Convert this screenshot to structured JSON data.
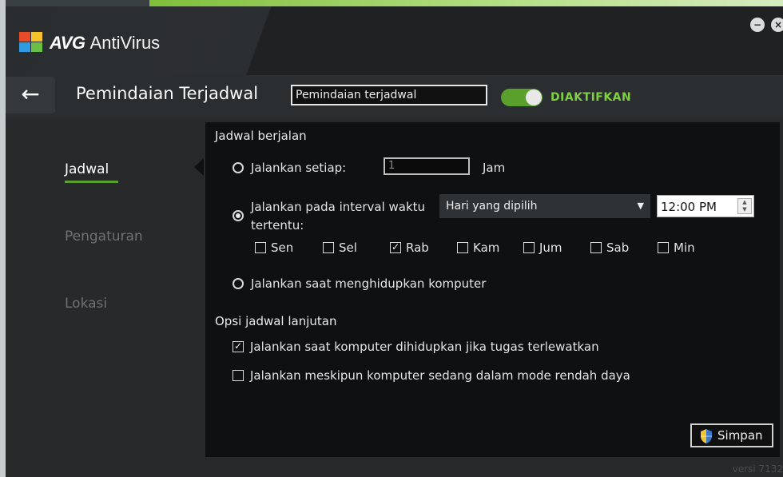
{
  "app": {
    "brand": "AVG",
    "product": "AntiVirus"
  },
  "window_controls": {
    "minimize": "−",
    "close": "×"
  },
  "title_bar": {
    "back_icon": "←",
    "page_title": "Pemindaian Terjadwal",
    "name_value": "Pemindaian terjadwal",
    "toggle_state": "on",
    "toggle_label": "DIAKTIFKAN"
  },
  "sidebar": {
    "items": [
      {
        "label": "Jadwal",
        "active": true
      },
      {
        "label": "Pengaturan",
        "active": false
      },
      {
        "label": "Lokasi",
        "active": false
      }
    ]
  },
  "schedule": {
    "section_title": "Jadwal berjalan",
    "run_every": {
      "label": "Jalankan setiap:",
      "value": "1",
      "unit": "Jam",
      "selected": false
    },
    "run_interval": {
      "label_line1": "Jalankan pada interval waktu",
      "label_line2": "tertentu:",
      "selected": true,
      "dropdown_value": "Hari yang dipilih",
      "dropdown_arrow": "▼",
      "time_value": "12:00 PM"
    },
    "days": [
      {
        "label": "Sen",
        "checked": false
      },
      {
        "label": "Sel",
        "checked": false
      },
      {
        "label": "Rab",
        "checked": true
      },
      {
        "label": "Kam",
        "checked": false
      },
      {
        "label": "Jum",
        "checked": false
      },
      {
        "label": "Sab",
        "checked": false
      },
      {
        "label": "Min",
        "checked": false
      }
    ],
    "run_on_boot": {
      "label": "Jalankan saat menghidupkan komputer",
      "selected": false
    }
  },
  "advanced": {
    "section_title": "Opsi jadwal lanjutan",
    "options": [
      {
        "label": "Jalankan saat komputer dihidupkan jika tugas terlewatkan",
        "checked": true
      },
      {
        "label": "Jalankan meskipun komputer sedang dalam mode rendah daya",
        "checked": false
      }
    ]
  },
  "save_button": {
    "label": "Simpan",
    "icon": "shield-icon"
  },
  "footer": {
    "version": "versi 7132"
  },
  "colors": {
    "accent": "#5aa02c",
    "toggle_label": "#7fd13f",
    "panel": "#0f1011",
    "window": "#27292b"
  }
}
